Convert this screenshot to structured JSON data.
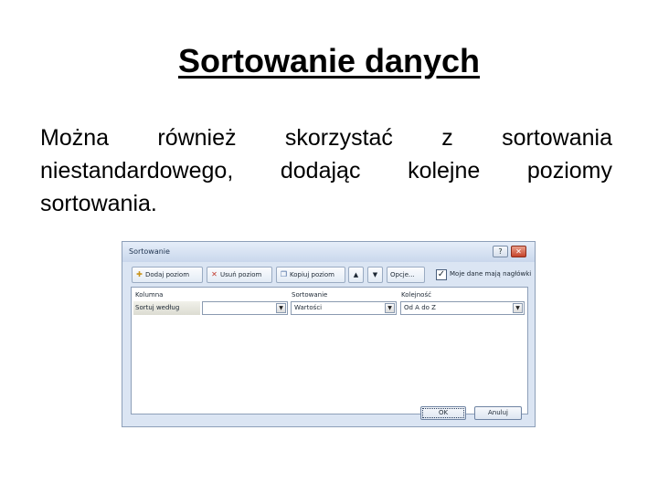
{
  "slide": {
    "title": "Sortowanie danych",
    "body": "Można również skorzystać z sortowania niestandardowego, dodając kolejne poziomy sortowania."
  },
  "dialog": {
    "title": "Sortowanie",
    "help_glyph": "?",
    "close_glyph": "✕",
    "toolbar": {
      "add_level": "Dodaj poziom",
      "delete_level": "Usuń poziom",
      "copy_level": "Kopiuj poziom",
      "move_up_glyph": "▲",
      "move_down_glyph": "▼",
      "options": "Opcje..."
    },
    "headers_checkbox": {
      "label": "Moje dane mają nagłówki",
      "checked": true,
      "glyph": "✓"
    },
    "columns": {
      "column": "Kolumna",
      "sort_on": "Sortowanie",
      "order": "Kolejność"
    },
    "rows": [
      {
        "label": "Sortuj według",
        "column_value": "",
        "sort_on_value": "Wartości",
        "order_value": "Od A do Z"
      }
    ],
    "ok": "OK",
    "cancel": "Anuluj"
  },
  "icons": {
    "add": "add-level-icon",
    "delete": "delete-icon",
    "copy": "copy-icon",
    "dropdown": "dropdown-arrow-icon"
  },
  "colors": {
    "dialog_bg": "#dbe5f3",
    "close_button": "#c6442b"
  }
}
